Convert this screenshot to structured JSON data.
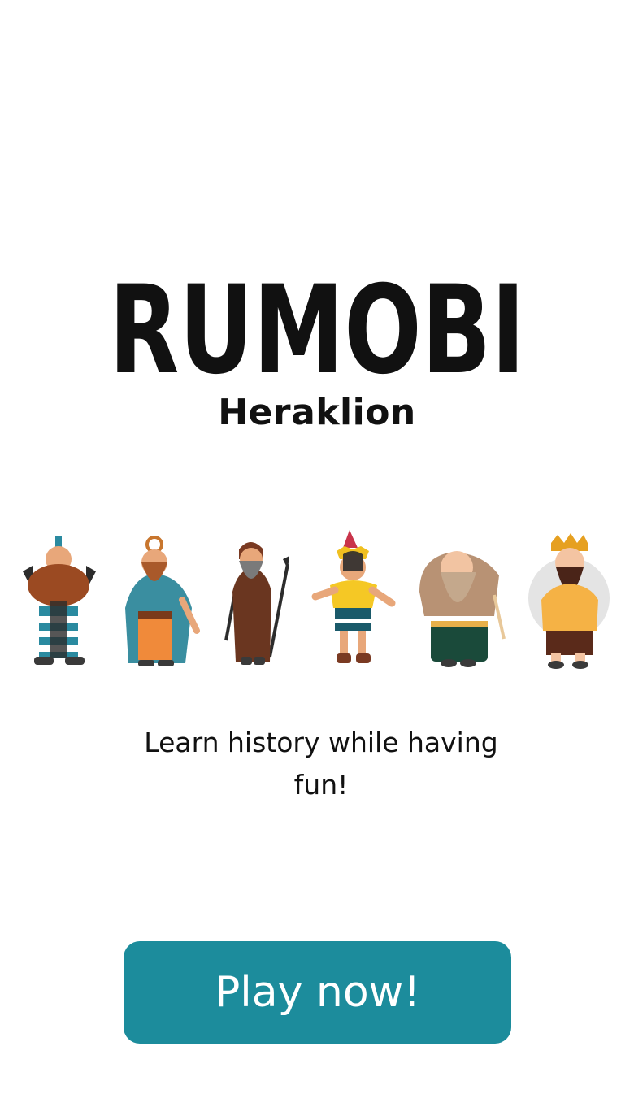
{
  "app": {
    "logo_text": "RUMOBI",
    "city": "Heraklion"
  },
  "characters": [
    {
      "name": "minoan-warrior-double-axe",
      "icon": "character-warrior-icon"
    },
    {
      "name": "priest-caped",
      "icon": "character-priest-icon"
    },
    {
      "name": "elder-with-spears",
      "icon": "character-elder-icon"
    },
    {
      "name": "prince-feathered-crown",
      "icon": "character-prince-icon"
    },
    {
      "name": "laughing-bearded-man",
      "icon": "character-laughing-man-icon"
    },
    {
      "name": "king-with-crown",
      "icon": "character-king-icon"
    }
  ],
  "tagline": "Learn history while having fun!",
  "cta": {
    "label": "Play now!"
  },
  "colors": {
    "background": "#ffffff",
    "text": "#111111",
    "accent": "#1c8c9c"
  }
}
